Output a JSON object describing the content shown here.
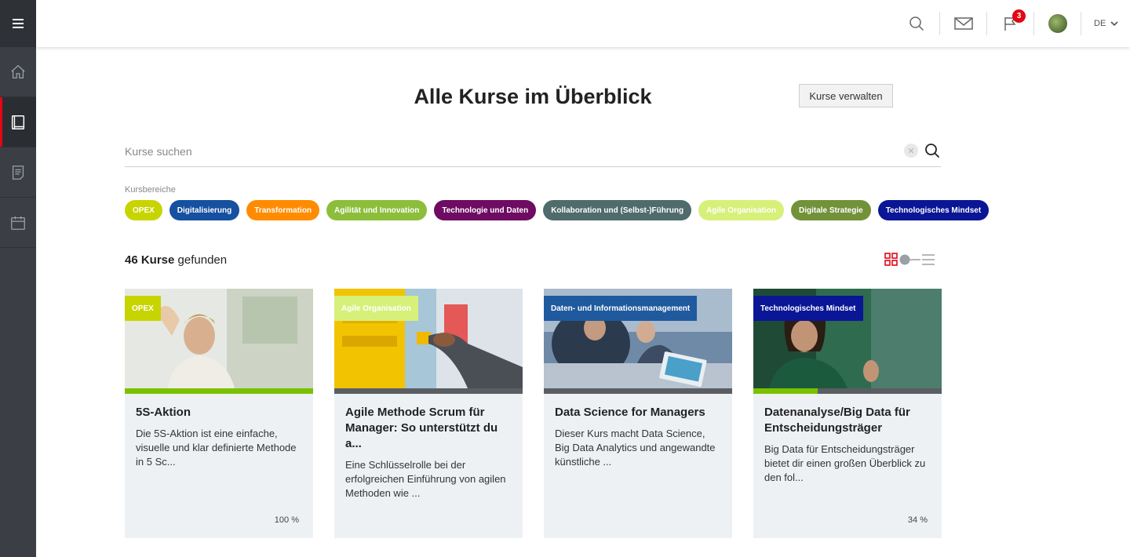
{
  "header": {
    "notifications_count": "3",
    "language": "DE"
  },
  "sidebar": {
    "items": [
      {
        "name": "home",
        "active": false
      },
      {
        "name": "courses",
        "active": true
      },
      {
        "name": "notes",
        "active": false
      },
      {
        "name": "calendar",
        "active": false
      }
    ]
  },
  "main": {
    "title": "Alle Kurse im Überblick",
    "manage_button": "Kurse verwalten",
    "search_placeholder": "Kurse suchen",
    "filter_label": "Kursbereiche",
    "results_count": "46 Kurse",
    "results_suffix": " gefunden"
  },
  "categories": [
    {
      "label": "OPEX",
      "color": "#c8d400"
    },
    {
      "label": "Digitalisierung",
      "color": "#1650a0"
    },
    {
      "label": "Transformation",
      "color": "#ff8c00"
    },
    {
      "label": "Agilität und Innovation",
      "color": "#8cbe3c"
    },
    {
      "label": "Technologie und Daten",
      "color": "#6e0b62"
    },
    {
      "label": "Kollaboration und (Selbst-)Führung",
      "color": "#4f6b6b"
    },
    {
      "label": "Agile Organisation",
      "color": "#d6f07a"
    },
    {
      "label": "Digitale Strategie",
      "color": "#72923a"
    },
    {
      "label": "Technologisches Mindset",
      "color": "#0a1696"
    }
  ],
  "cards": [
    {
      "tag": "OPEX",
      "tag_color": "#c8d400",
      "title": "5S-Aktion",
      "description": "Die 5S-Aktion ist eine einfache, visuelle und klar definierte Methode in 5 Sc...",
      "progress_percent": 100,
      "progress_label": "100 %"
    },
    {
      "tag": "Agile Organisation",
      "tag_color": "#d6f07a",
      "title": "Agile Methode Scrum für Manager: So unterstützt du a...",
      "description": "Eine Schlüsselrolle bei der erfolgreichen Einführung von agilen Methoden wie ...",
      "progress_percent": 0,
      "progress_label": ""
    },
    {
      "tag": "Daten- und Informationsmanagement",
      "tag_color": "#1f5a9e",
      "title": "Data Science for Managers",
      "description": "Dieser Kurs macht Data Science, Big Data Analytics und angewandte künstliche ...",
      "progress_percent": 0,
      "progress_label": ""
    },
    {
      "tag": "Technologisches Mindset",
      "tag_color": "#0a1696",
      "title": "Datenanalyse/Big Data für Entscheidungsträger",
      "description": "Big Data für Entscheidungsträger bietet dir einen großen Überblick zu den fol...",
      "progress_percent": 34,
      "progress_label": "34 %"
    }
  ]
}
